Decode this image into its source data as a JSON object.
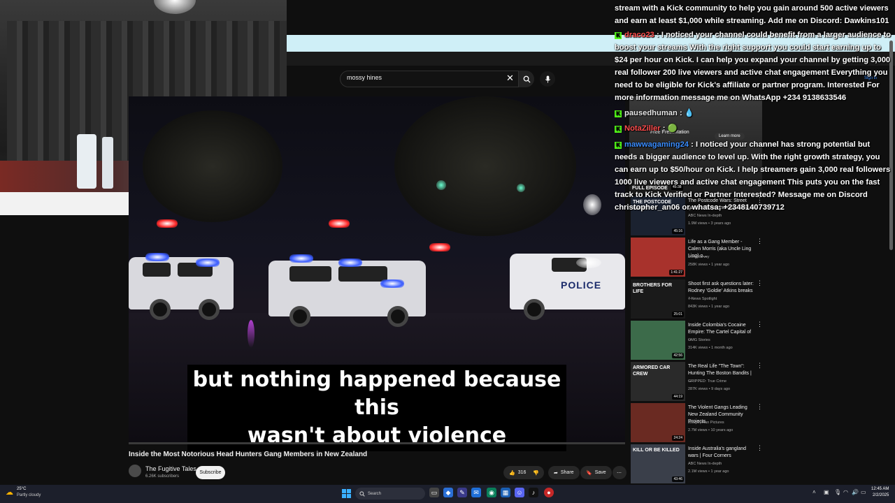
{
  "search": {
    "query": "mossy hines"
  },
  "video": {
    "caption_line1": "but nothing happened because this",
    "caption_line2": "wasn't about violence",
    "car_text": "POLICE",
    "title": "Inside the Most Notorious Head Hunters Gang Members in New Zealand",
    "channel": "The Fugitive Tales",
    "subscribers": "6.26K subscribers",
    "subscribe_label": "Subscribe",
    "likes": "316",
    "share_label": "Share",
    "save_label": "Save"
  },
  "ad": {
    "text": "Free Presentation",
    "learn_more": "Learn more",
    "top_badge": "FULL EPISODE",
    "duration": "45:38",
    "sign_in": "Sign in"
  },
  "recommendations": [
    {
      "title": "The Postcode Wars: Street gangs, drugs and organised ...",
      "channel": "ABC News In-depth",
      "meta": "1.9M views • 3 years ago",
      "duration": "45:16",
      "thumb_text": "THE POSTCODE WARS",
      "thumb_color": "#1b2230"
    },
    {
      "title": "Life as a Gang Member - Calen Morris (aka Uncle Ling Ling) o...",
      "channel": "Dom Harvey",
      "meta": "258K views • 1 year ago",
      "duration": "1:41:27",
      "thumb_text": "",
      "thumb_color": "#a8322c"
    },
    {
      "title": "Shoot first ask questions later: Rodney 'Goldie' Atkins breaks ...",
      "channel": "7 News Spotlight",
      "meta": "843K views • 1 year ago",
      "duration": "25:01",
      "thumb_text": "BROTHERS FOR LIFE",
      "thumb_color": "#1a1a1a"
    },
    {
      "title": "Inside Colombia's Cocaine Empire: The Cartel Capital of ...",
      "channel": "OMG Stories",
      "meta": "314K views • 1 month ago",
      "duration": "42:56",
      "thumb_text": "",
      "thumb_color": "#3c6b4a"
    },
    {
      "title": "The Real Life \"The Town\": Hunting The Boston Bandits | ...",
      "channel": "GRIPPED: True Crime",
      "meta": "287K views • 9 days ago",
      "duration": "44:19",
      "thumb_text": "ARMORED CAR CREW",
      "thumb_color": "#2a2a2a"
    },
    {
      "title": "The Violent Gangs Leading New Zealand Community Projects",
      "channel": "Journeyman Pictures",
      "meta": "2.7M views • 10 years ago",
      "duration": "24:24",
      "thumb_text": "",
      "thumb_color": "#6a2a22"
    },
    {
      "title": "Inside Australia's gangland wars | Four Corners",
      "channel": "ABC News In-depth",
      "meta": "2.1M views • 1 year ago",
      "duration": "43:46",
      "thumb_text": "KILL OR BE KILLED",
      "thumb_color": "#3a3f4a"
    }
  ],
  "chat": {
    "msg0_text": "stream with a Kick community to help you gain around 500 active viewers and earn at least $1,000 while streaming. Add me on Discord: Dawkins101",
    "msg1_user": "draco23",
    "msg1_text": "I noticed your channel could benefit from a larger audience to boost your streams With the right support you could start earning up to $24 per hour on Kick. I can help you expand your channel by getting 3,000 real follower 200 live viewers and active chat engagement Everything you need to be eligible for Kick's affiliate or partner program. Interested For more information message me on WhatsApp +234 9138633546",
    "msg2_user": "pausedhuman",
    "msg2_text": "💧",
    "msg3_user": "NotaZiller",
    "msg3_text": "🟢",
    "msg4_user": "mawwagaming24",
    "msg4_text": "I noticed your channel has strong potential but needs a bigger audience to level up. With the right growth strategy, you can earn up to $50/hour on Kick. I help streamers gain 3,000 real followers 1000 live viewers and active chat engagement This puts you on the fast track to Kick Verified or Partner Interested? Message me on Discord christopher_an06 or whatsa; +2348140739712",
    "badge": "K"
  },
  "taskbar": {
    "weather_temp": "25°C",
    "weather_cond": "Partly cloudy",
    "search_placeholder": "Search",
    "time": "12:45 AM",
    "date": "2/2/2025"
  },
  "colors": {
    "kick_green": "#53fc18",
    "youtube_bg": "#0f0f0f",
    "chat_user_red": "#ff4d4d",
    "chat_user_blue": "#3a8dff"
  },
  "icons": [
    "search-icon",
    "mic-icon",
    "close-icon",
    "like-icon",
    "dislike-icon",
    "share-icon",
    "save-icon",
    "more-icon",
    "windows-start-icon",
    "weather-icon"
  ]
}
